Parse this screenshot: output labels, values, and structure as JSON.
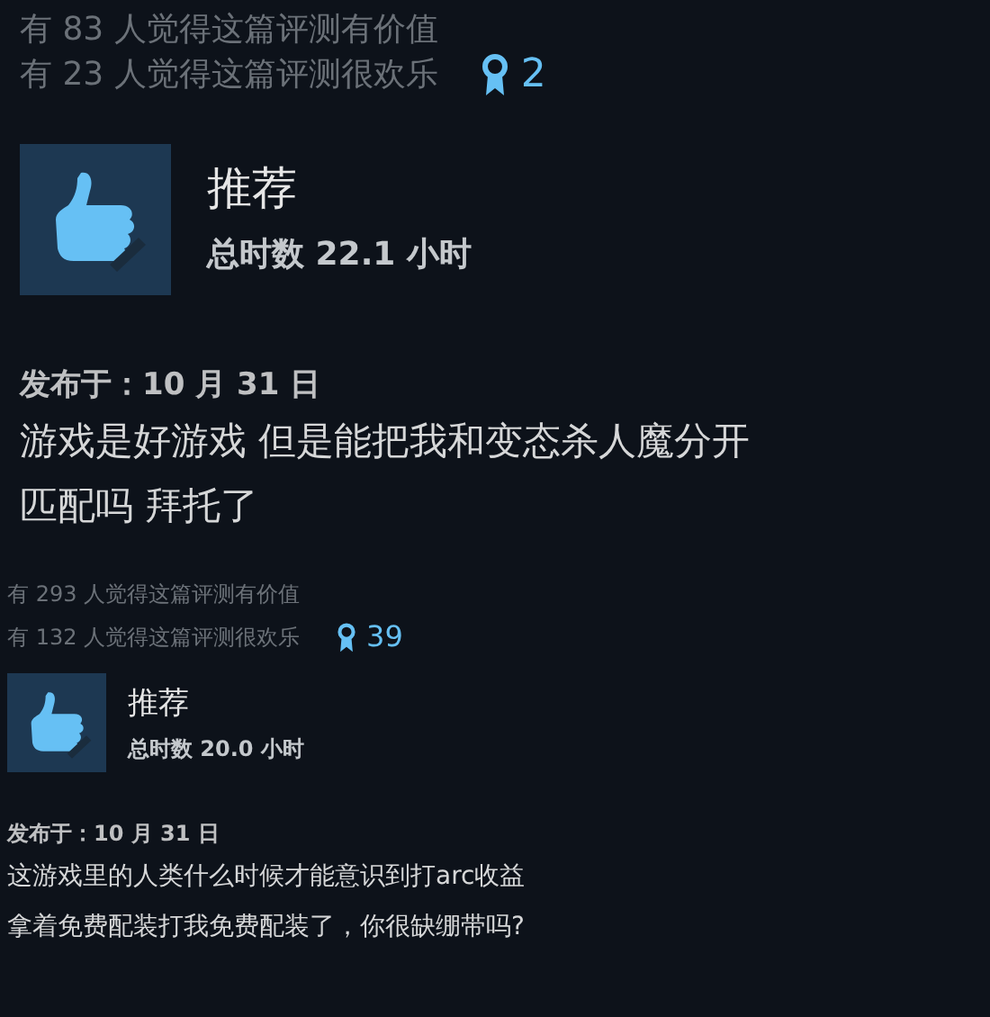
{
  "reviews": [
    {
      "kind": "large",
      "helpful": "有 83 人觉得这篇评测有价值",
      "funny": "有 23 人觉得这篇评测很欢乐",
      "awards": "2",
      "verdict": "推荐",
      "hours": "总时数 22.1 小时",
      "posted": "发布于：10 月 31 日",
      "body": [
        "游戏是好游戏 但是能把我和变态杀人魔分开",
        "匹配吗 拜托了"
      ]
    },
    {
      "kind": "small",
      "helpful": "有 293 人觉得这篇评测有价值",
      "funny": "有 132 人觉得这篇评测很欢乐",
      "awards": "39",
      "verdict": "推荐",
      "hours": "总时数 20.0 小时",
      "posted": "发布于：10 月 31 日",
      "body": [
        "这游戏里的人类什么时候才能意识到打arc收益",
        "拿着免费配装打我免费配装了，你很缺绷带吗?"
      ]
    }
  ]
}
